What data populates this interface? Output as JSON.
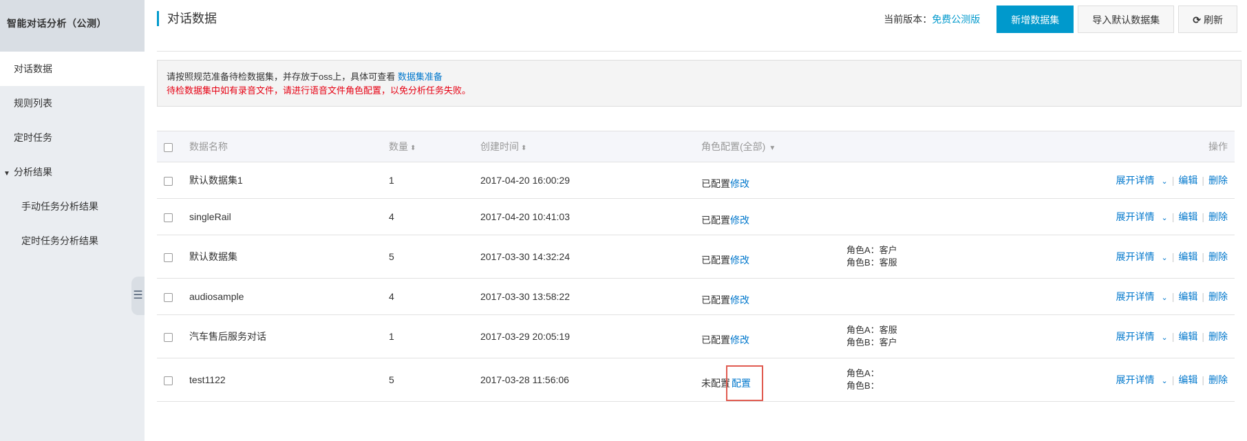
{
  "sidebar": {
    "title": "智能对话分析（公测）",
    "items": [
      {
        "label": "对话数据",
        "active": true
      },
      {
        "label": "规则列表"
      },
      {
        "label": "定时任务"
      }
    ],
    "group": {
      "label": "分析结果",
      "caret": "▼"
    },
    "sub_items": [
      {
        "label": "手动任务分析结果"
      },
      {
        "label": "定时任务分析结果"
      }
    ],
    "collapse_icon": "☰"
  },
  "header": {
    "title": "对话数据",
    "version_label": "当前版本：",
    "version_value": "免费公测版",
    "btn_new": "新增数据集",
    "btn_import": "导入默认数据集",
    "btn_refresh": "刷新",
    "refresh_icon": "⟳"
  },
  "notice": {
    "line1_text": "请按照规范准备待检数据集，并存放于oss上，具体可查看",
    "line1_link": "数据集准备",
    "line2": "待检数据集中如有录音文件，请进行语音文件角色配置，以免分析任务失败。"
  },
  "table": {
    "headers": {
      "name": "数据名称",
      "count": "数量",
      "time": "创建时间",
      "role": "角色配置(全部)",
      "ops": "操作"
    },
    "sort_icon": "⬍",
    "filter_icon": "▼",
    "ops_labels": {
      "expand": "展开详情",
      "chevron": "⌄",
      "edit": "编辑",
      "delete": "删除",
      "sep": "|"
    },
    "rows": [
      {
        "name": "默认数据集1",
        "count": "1",
        "time": "2017-04-20 16:00:29",
        "status": "已配置",
        "action": "修改",
        "roleA": "",
        "roleB": ""
      },
      {
        "name": "singleRail",
        "count": "4",
        "time": "2017-04-20 10:41:03",
        "status": "已配置",
        "action": "修改",
        "roleA": "",
        "roleB": ""
      },
      {
        "name": "默认数据集",
        "count": "5",
        "time": "2017-03-30 14:32:24",
        "status": "已配置",
        "action": "修改",
        "roleA": "角色A：客户",
        "roleB": "角色B：客服"
      },
      {
        "name": "audiosample",
        "count": "4",
        "time": "2017-03-30 13:58:22",
        "status": "已配置",
        "action": "修改",
        "roleA": "",
        "roleB": ""
      },
      {
        "name": "汽车售后服务对话",
        "count": "1",
        "time": "2017-03-29 20:05:19",
        "status": "已配置",
        "action": "修改",
        "roleA": "角色A：客服",
        "roleB": "角色B：客户"
      },
      {
        "name": "test1122",
        "count": "5",
        "time": "2017-03-28 11:56:06",
        "status": "未配置",
        "action": "配置",
        "roleA": "角色A：",
        "roleB": "角色B："
      }
    ]
  }
}
